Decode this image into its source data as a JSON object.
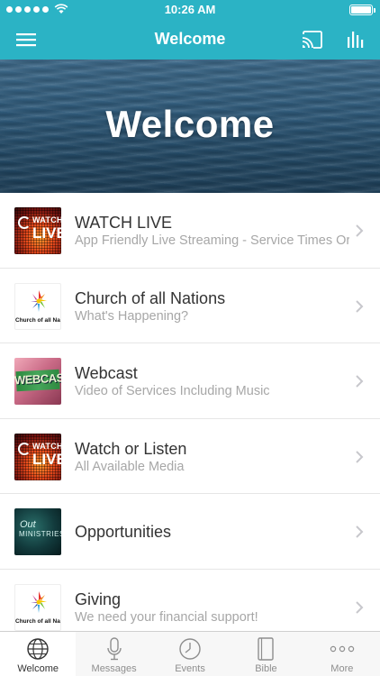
{
  "status_bar": {
    "time": "10:26 AM",
    "signal_bars": 5,
    "battery_level": 1.0
  },
  "nav": {
    "title": "Welcome",
    "menu_icon": "hamburger-menu-icon",
    "cast_icon": "cast-icon",
    "stats_icon": "bar-chart-icon"
  },
  "hero": {
    "title": "Welcome"
  },
  "list": {
    "items": [
      {
        "title": "WATCH LIVE",
        "subtitle": "App Friendly Live Streaming - Service Times Or",
        "thumb": "watch-live-thumbnail",
        "thumb_line1": "WATCH",
        "thumb_line2": "LIVE"
      },
      {
        "title": "Church of all Nations",
        "subtitle": "What's Happening?",
        "thumb": "church-logo-thumbnail",
        "thumb_caption": "Church of all Nations"
      },
      {
        "title": "Webcast",
        "subtitle": "Video of Services Including Music",
        "thumb": "webcast-thumbnail",
        "thumb_text": "WEBCAST"
      },
      {
        "title": "Watch or Listen",
        "subtitle": "All Available Media",
        "thumb": "watch-live-thumbnail",
        "thumb_line1": "WATCH",
        "thumb_line2": "LIVE"
      },
      {
        "title": "Opportunities",
        "subtitle": "",
        "thumb": "ministries-thumbnail",
        "thumb_line1": "Out",
        "thumb_line2": "MINISTRIES"
      },
      {
        "title": "Giving",
        "subtitle": "We need your financial support!",
        "thumb": "church-logo-thumbnail",
        "thumb_caption": "Church of all Nations"
      }
    ]
  },
  "tab_bar": {
    "tabs": [
      {
        "label": "Welcome",
        "icon": "globe-icon",
        "active": true
      },
      {
        "label": "Messages",
        "icon": "microphone-icon",
        "active": false
      },
      {
        "label": "Events",
        "icon": "clock-icon",
        "active": false
      },
      {
        "label": "Bible",
        "icon": "book-icon",
        "active": false
      },
      {
        "label": "More",
        "icon": "more-dots-icon",
        "active": false
      }
    ]
  },
  "colors": {
    "accent": "#2bb3c5",
    "title_text": "#333333",
    "subtitle_text": "#a7a7a7",
    "tab_bar_bg": "#f7f7f7"
  }
}
